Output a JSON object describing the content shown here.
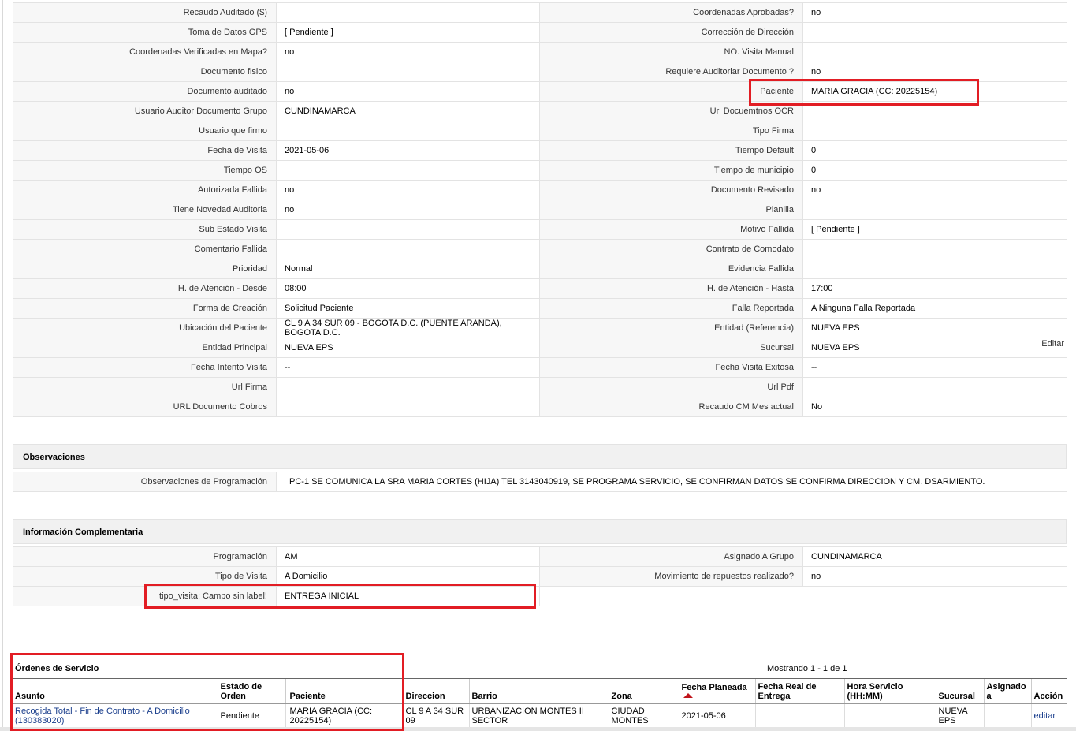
{
  "details": {
    "rows": [
      {
        "l1": "Recaudo Auditado ($)",
        "v1": "",
        "l2": "Coordenadas Aprobadas?",
        "v2": "no"
      },
      {
        "l1": "Toma de Datos GPS",
        "v1": "[ Pendiente ]",
        "l2": "Corrección de Dirección",
        "v2": ""
      },
      {
        "l1": "Coordenadas Verificadas en Mapa?",
        "v1": "no",
        "l2": "NO. Visita Manual",
        "v2": ""
      },
      {
        "l1": "Documento fisico",
        "v1": "",
        "l2": "Requiere Auditoriar Documento ?",
        "v2": "no"
      },
      {
        "l1": "Documento auditado",
        "v1": "no",
        "l2": "Paciente",
        "v2": "MARIA GRACIA (CC: 20225154)"
      },
      {
        "l1": "Usuario Auditor Documento Grupo",
        "v1": "CUNDINAMARCA",
        "l2": "Url Docuemtnos OCR",
        "v2": ""
      },
      {
        "l1": "Usuario que firmo",
        "v1": "",
        "l2": "Tipo Firma",
        "v2": ""
      },
      {
        "l1": "Fecha de Visita",
        "v1": "2021-05-06",
        "l2": "Tiempo Default",
        "v2": "0"
      },
      {
        "l1": "Tiempo OS",
        "v1": "",
        "l2": "Tiempo de municipio",
        "v2": "0"
      },
      {
        "l1": "Autorizada Fallida",
        "v1": "no",
        "l2": "Documento Revisado",
        "v2": "no"
      },
      {
        "l1": "Tiene Novedad Auditoria",
        "v1": "no",
        "l2": "Planilla",
        "v2": ""
      },
      {
        "l1": "Sub Estado Visita",
        "v1": "",
        "l2": "Motivo Fallida",
        "v2": "[ Pendiente ]"
      },
      {
        "l1": "Comentario Fallida",
        "v1": "",
        "l2": "Contrato de Comodato",
        "v2": ""
      },
      {
        "l1": "Prioridad",
        "v1": "Normal",
        "l2": "Evidencia Fallida",
        "v2": ""
      },
      {
        "l1": "H. de Atención - Desde",
        "v1": "08:00",
        "l2": "H. de Atención - Hasta",
        "v2": "17:00"
      },
      {
        "l1": "Forma de Creación",
        "v1": "Solicitud Paciente",
        "l2": "Falla Reportada",
        "v2": "A Ninguna Falla Reportada"
      },
      {
        "l1": "Ubicación del Paciente",
        "v1": "CL 9 A 34 SUR 09 - BOGOTA D.C. (PUENTE ARANDA), BOGOTA D.C.",
        "l2": "Entidad (Referencia)",
        "v2": "NUEVA EPS"
      },
      {
        "l1": "Entidad Principal",
        "v1": "NUEVA EPS",
        "l2": "Sucursal",
        "v2": "NUEVA EPS"
      },
      {
        "l1": "Fecha Intento Visita",
        "v1": "--",
        "l2": "Fecha Visita Exitosa",
        "v2": "--"
      },
      {
        "l1": "Url Firma",
        "v1": "",
        "l2": "Url Pdf",
        "v2": ""
      },
      {
        "l1": "URL Documento Cobros",
        "v1": "",
        "l2": "Recaudo CM Mes actual",
        "v2": "No"
      }
    ],
    "edit_label": "Editar"
  },
  "observaciones": {
    "title": "Observaciones",
    "label": "Observaciones de Programación",
    "value": "PC-1 SE COMUNICA LA SRA MARIA CORTES (HIJA) TEL 3143040919, SE PROGRAMA SERVICIO, SE CONFIRMAN DATOS SE CONFIRMA DIRECCION Y CM. DSARMIENTO."
  },
  "complementaria": {
    "title": "Información Complementaria",
    "rows": [
      {
        "l1": "Programación",
        "v1": "AM",
        "l2": "Asignado A Grupo",
        "v2": "CUNDINAMARCA"
      },
      {
        "l1": "Tipo de Visita",
        "v1": "A Domicilio",
        "l2": "Movimiento de repuestos realizado?",
        "v2": "no"
      }
    ],
    "extra": {
      "label": "tipo_visita: Campo sin label!",
      "value": "ENTREGA INICIAL"
    }
  },
  "ordenes": {
    "title": "Órdenes de Servicio",
    "showing": "Mostrando 1 - 1 de 1",
    "headers": {
      "asunto": "Asunto",
      "estado": "Estado de Orden",
      "paciente": "Paciente",
      "direccion": "Direccion",
      "barrio": "Barrio",
      "zona": "Zona",
      "fecha_planeada": "Fecha Planeada",
      "fecha_real": "Fecha Real de Entrega",
      "hora": "Hora Servicio (HH:MM)",
      "sucursal": "Sucursal",
      "asignado": "Asignado a",
      "accion": "Acción"
    },
    "row": {
      "asunto": "Recogida Total - Fin de Contrato - A Domicilio (130383020)",
      "estado": "Pendiente",
      "paciente": "MARIA GRACIA (CC: 20225154)",
      "direccion": "CL 9 A 34 SUR 09",
      "barrio": "URBANIZACION MONTES II SECTOR",
      "zona": "CIUDAD MONTES",
      "fecha_planeada": "2021-05-06",
      "fecha_real": "",
      "hora": "",
      "sucursal": "NUEVA EPS",
      "asignado": "",
      "accion": "editar"
    }
  },
  "colors": {
    "highlight": "#e21d24",
    "link": "#1a3e8c"
  }
}
